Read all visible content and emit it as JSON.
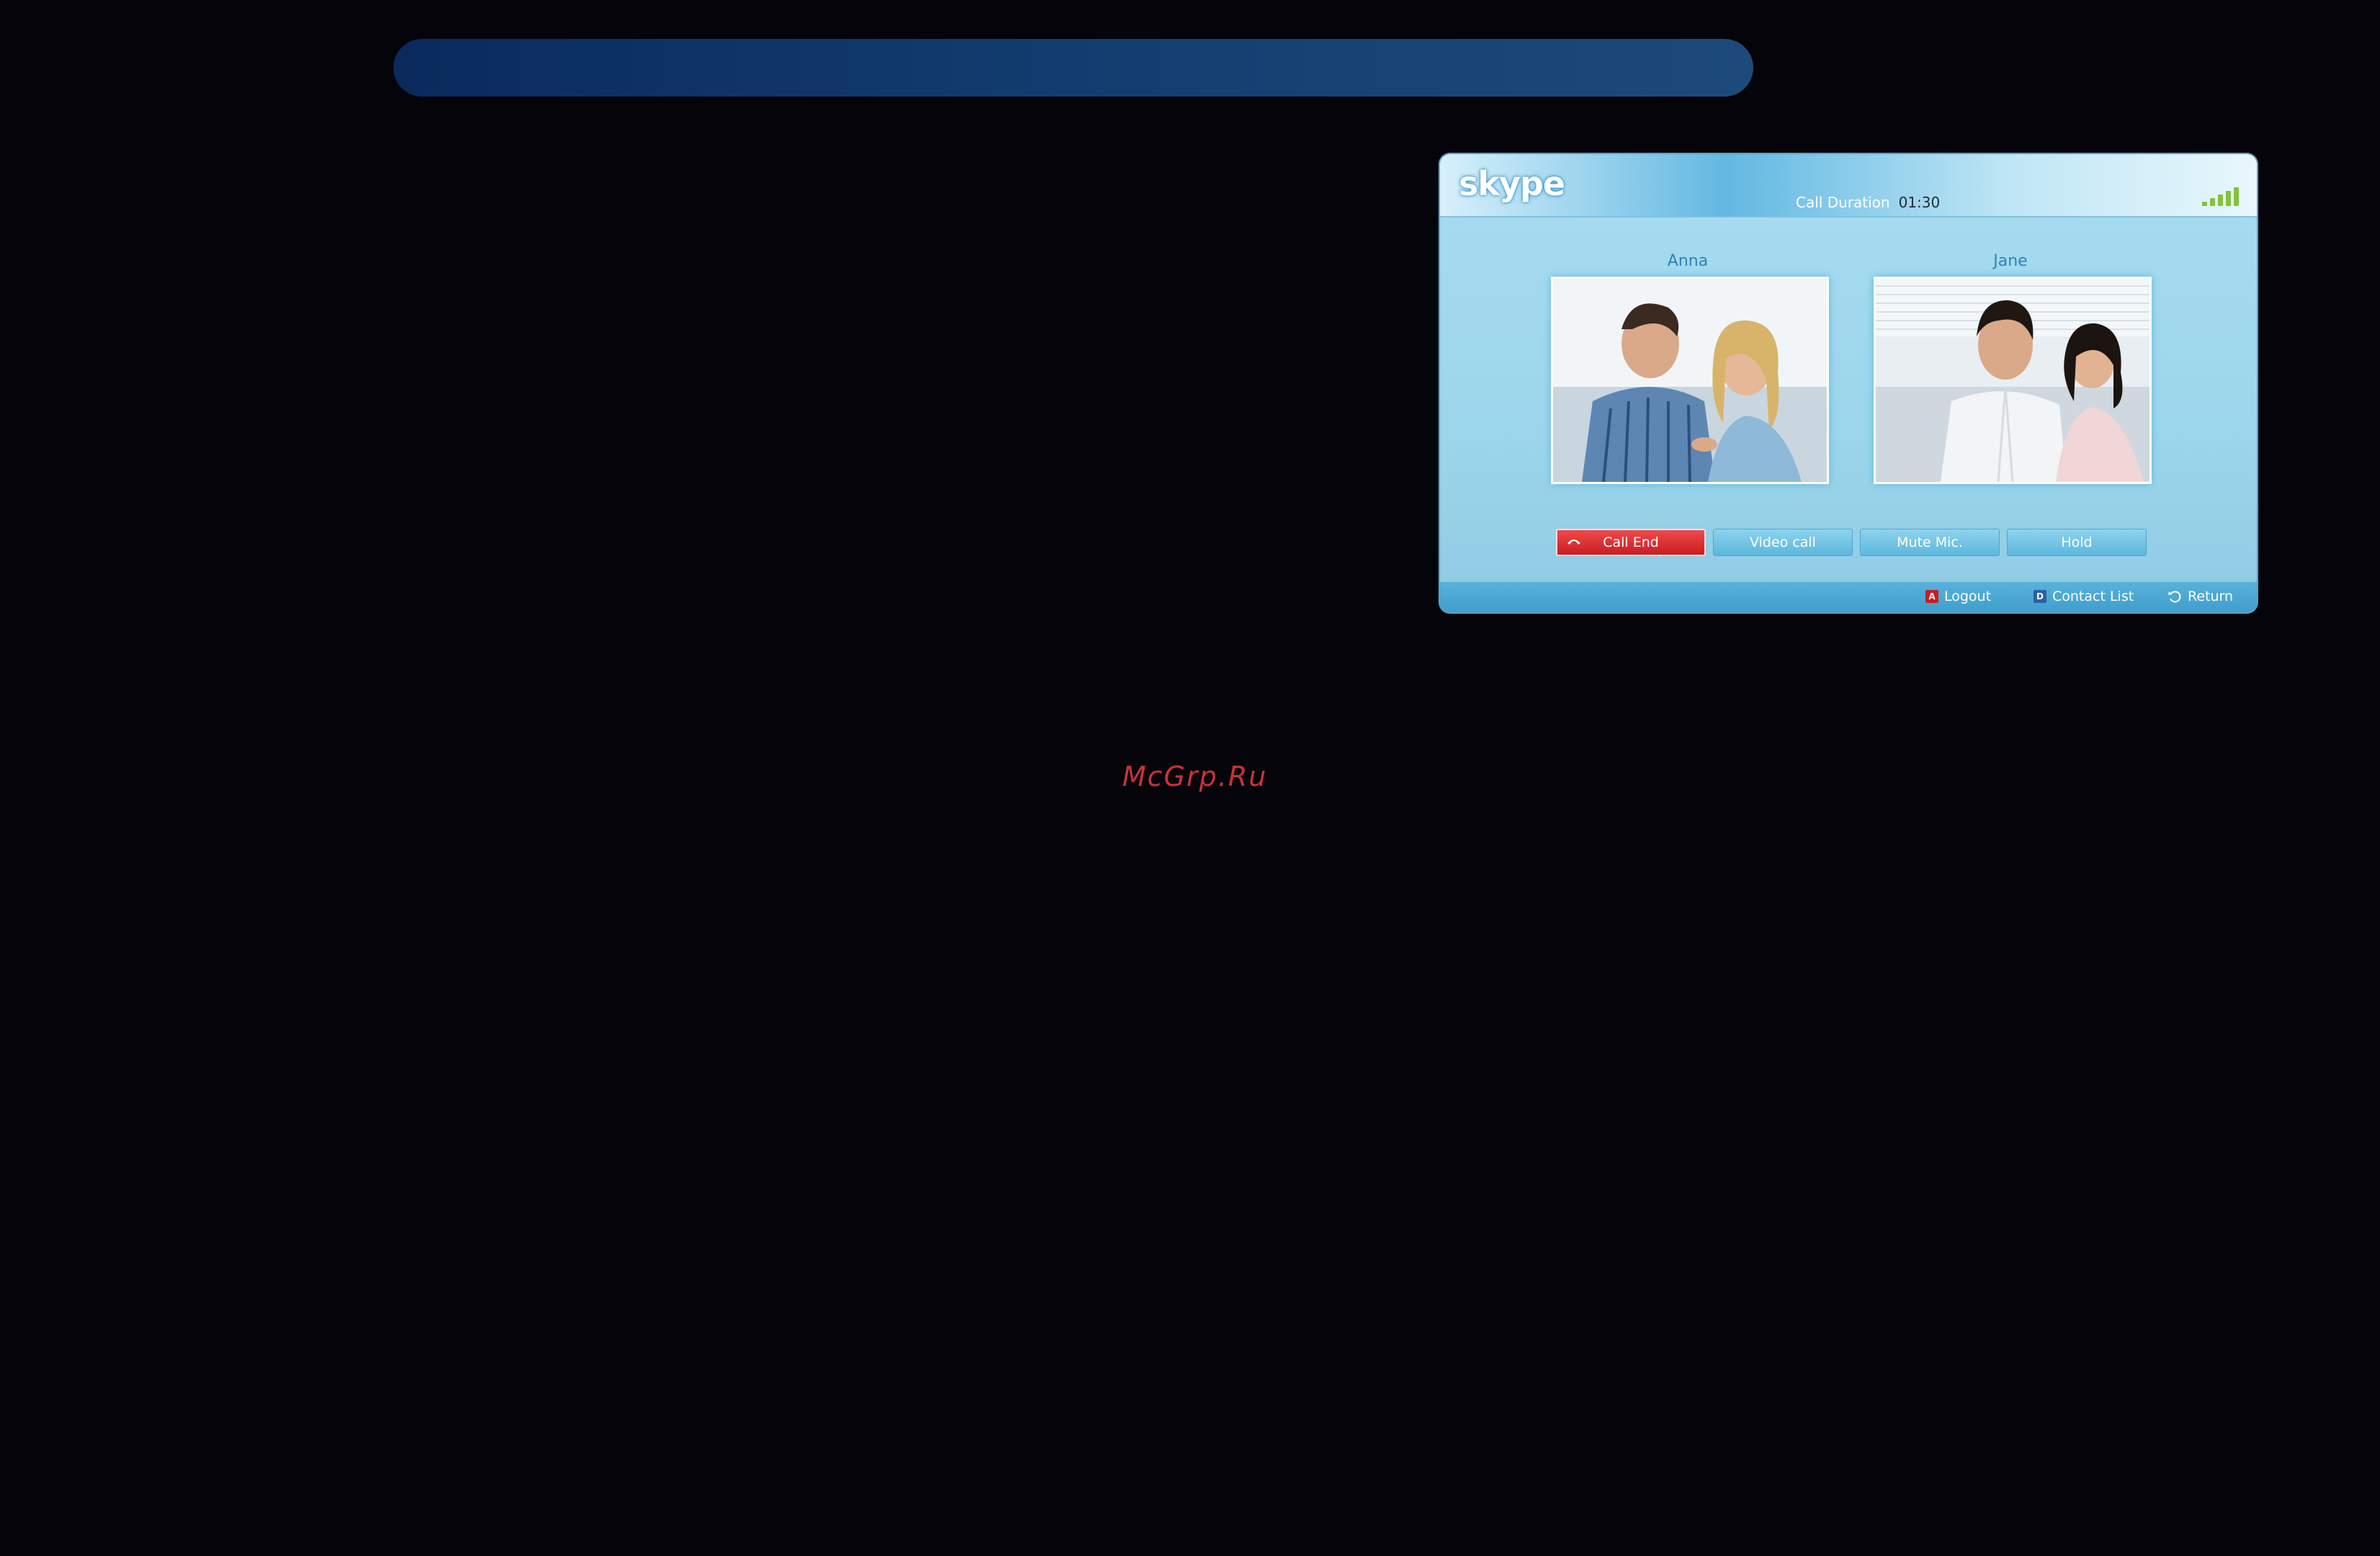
{
  "app": {
    "logo_text": "skype"
  },
  "header": {
    "call_duration_label": "Call Duration",
    "call_duration_value": "01:30",
    "signal_icon": "signal-strength-icon"
  },
  "participants": [
    {
      "name": "Anna",
      "icon": "video-feed-couple-icon"
    },
    {
      "name": "Jane",
      "icon": "video-feed-couple-icon"
    }
  ],
  "controls": {
    "call_end": "Call End",
    "video_call": "Video call",
    "mute_mic": "Mute Mic.",
    "hold": "Hold"
  },
  "footer": {
    "logout_key": "A",
    "logout_label": "Logout",
    "contact_list_key": "D",
    "contact_list_label": "Contact List",
    "return_label": "Return"
  },
  "watermark": "McGrp.Ru",
  "colors": {
    "background": "#05040a",
    "accent": "#5cb7dd",
    "end_call": "#c81d22",
    "watermark": "#c8323a"
  }
}
